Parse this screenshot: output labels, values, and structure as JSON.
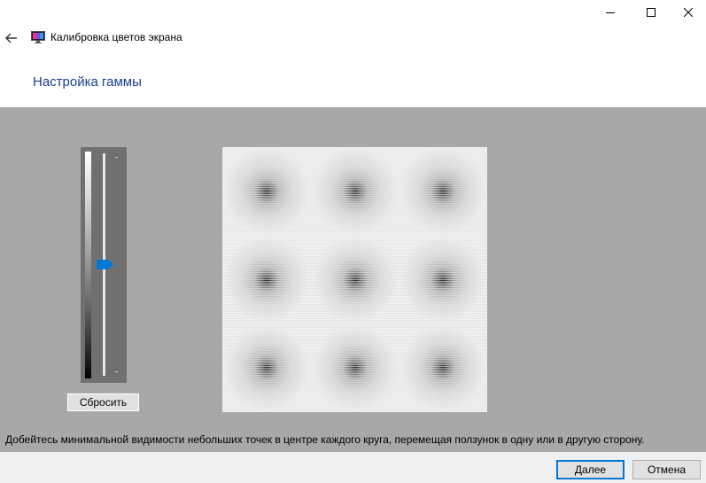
{
  "window": {
    "title": "Калибровка цветов экрана",
    "controls": [
      "minimize-icon",
      "maximize-icon",
      "close-icon"
    ]
  },
  "nav": {
    "back_icon": "back-arrow-icon",
    "app_icon": "display-calibration-icon"
  },
  "page": {
    "heading": "Настройка гаммы",
    "instruction": "Добейтесь минимальной видимости небольших точек в центре каждого круга, перемещая ползунок в одну или в другую сторону."
  },
  "gamma_slider": {
    "level": 0.5,
    "thumb_color": "#0078d7",
    "reset_label": "Сбросить"
  },
  "pattern": {
    "rows": 3,
    "cols": 3
  },
  "footer": {
    "next_label": "Далее",
    "cancel_label": "Отмена"
  },
  "colors": {
    "heading": "#1a3e8c",
    "work_area": "#a8a8a8",
    "accent": "#0078d7"
  }
}
